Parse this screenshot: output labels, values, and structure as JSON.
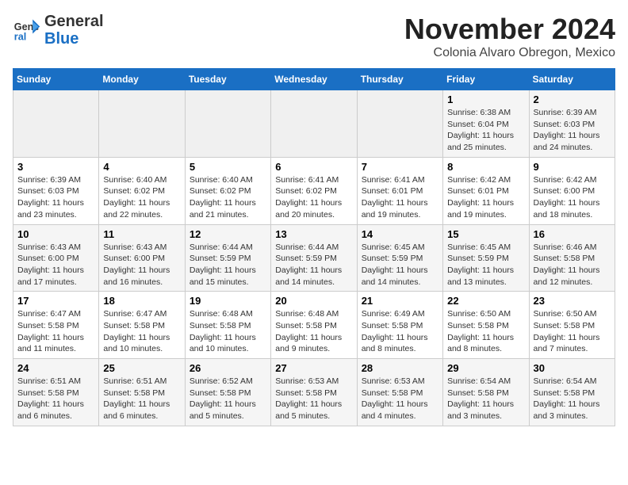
{
  "logo": {
    "general": "General",
    "blue": "Blue"
  },
  "header": {
    "month": "November 2024",
    "location": "Colonia Alvaro Obregon, Mexico"
  },
  "weekdays": [
    "Sunday",
    "Monday",
    "Tuesday",
    "Wednesday",
    "Thursday",
    "Friday",
    "Saturday"
  ],
  "weeks": [
    [
      {
        "day": "",
        "info": ""
      },
      {
        "day": "",
        "info": ""
      },
      {
        "day": "",
        "info": ""
      },
      {
        "day": "",
        "info": ""
      },
      {
        "day": "",
        "info": ""
      },
      {
        "day": "1",
        "info": "Sunrise: 6:38 AM\nSunset: 6:04 PM\nDaylight: 11 hours and 25 minutes."
      },
      {
        "day": "2",
        "info": "Sunrise: 6:39 AM\nSunset: 6:03 PM\nDaylight: 11 hours and 24 minutes."
      }
    ],
    [
      {
        "day": "3",
        "info": "Sunrise: 6:39 AM\nSunset: 6:03 PM\nDaylight: 11 hours and 23 minutes."
      },
      {
        "day": "4",
        "info": "Sunrise: 6:40 AM\nSunset: 6:02 PM\nDaylight: 11 hours and 22 minutes."
      },
      {
        "day": "5",
        "info": "Sunrise: 6:40 AM\nSunset: 6:02 PM\nDaylight: 11 hours and 21 minutes."
      },
      {
        "day": "6",
        "info": "Sunrise: 6:41 AM\nSunset: 6:02 PM\nDaylight: 11 hours and 20 minutes."
      },
      {
        "day": "7",
        "info": "Sunrise: 6:41 AM\nSunset: 6:01 PM\nDaylight: 11 hours and 19 minutes."
      },
      {
        "day": "8",
        "info": "Sunrise: 6:42 AM\nSunset: 6:01 PM\nDaylight: 11 hours and 19 minutes."
      },
      {
        "day": "9",
        "info": "Sunrise: 6:42 AM\nSunset: 6:00 PM\nDaylight: 11 hours and 18 minutes."
      }
    ],
    [
      {
        "day": "10",
        "info": "Sunrise: 6:43 AM\nSunset: 6:00 PM\nDaylight: 11 hours and 17 minutes."
      },
      {
        "day": "11",
        "info": "Sunrise: 6:43 AM\nSunset: 6:00 PM\nDaylight: 11 hours and 16 minutes."
      },
      {
        "day": "12",
        "info": "Sunrise: 6:44 AM\nSunset: 5:59 PM\nDaylight: 11 hours and 15 minutes."
      },
      {
        "day": "13",
        "info": "Sunrise: 6:44 AM\nSunset: 5:59 PM\nDaylight: 11 hours and 14 minutes."
      },
      {
        "day": "14",
        "info": "Sunrise: 6:45 AM\nSunset: 5:59 PM\nDaylight: 11 hours and 14 minutes."
      },
      {
        "day": "15",
        "info": "Sunrise: 6:45 AM\nSunset: 5:59 PM\nDaylight: 11 hours and 13 minutes."
      },
      {
        "day": "16",
        "info": "Sunrise: 6:46 AM\nSunset: 5:58 PM\nDaylight: 11 hours and 12 minutes."
      }
    ],
    [
      {
        "day": "17",
        "info": "Sunrise: 6:47 AM\nSunset: 5:58 PM\nDaylight: 11 hours and 11 minutes."
      },
      {
        "day": "18",
        "info": "Sunrise: 6:47 AM\nSunset: 5:58 PM\nDaylight: 11 hours and 10 minutes."
      },
      {
        "day": "19",
        "info": "Sunrise: 6:48 AM\nSunset: 5:58 PM\nDaylight: 11 hours and 10 minutes."
      },
      {
        "day": "20",
        "info": "Sunrise: 6:48 AM\nSunset: 5:58 PM\nDaylight: 11 hours and 9 minutes."
      },
      {
        "day": "21",
        "info": "Sunrise: 6:49 AM\nSunset: 5:58 PM\nDaylight: 11 hours and 8 minutes."
      },
      {
        "day": "22",
        "info": "Sunrise: 6:50 AM\nSunset: 5:58 PM\nDaylight: 11 hours and 8 minutes."
      },
      {
        "day": "23",
        "info": "Sunrise: 6:50 AM\nSunset: 5:58 PM\nDaylight: 11 hours and 7 minutes."
      }
    ],
    [
      {
        "day": "24",
        "info": "Sunrise: 6:51 AM\nSunset: 5:58 PM\nDaylight: 11 hours and 6 minutes."
      },
      {
        "day": "25",
        "info": "Sunrise: 6:51 AM\nSunset: 5:58 PM\nDaylight: 11 hours and 6 minutes."
      },
      {
        "day": "26",
        "info": "Sunrise: 6:52 AM\nSunset: 5:58 PM\nDaylight: 11 hours and 5 minutes."
      },
      {
        "day": "27",
        "info": "Sunrise: 6:53 AM\nSunset: 5:58 PM\nDaylight: 11 hours and 5 minutes."
      },
      {
        "day": "28",
        "info": "Sunrise: 6:53 AM\nSunset: 5:58 PM\nDaylight: 11 hours and 4 minutes."
      },
      {
        "day": "29",
        "info": "Sunrise: 6:54 AM\nSunset: 5:58 PM\nDaylight: 11 hours and 3 minutes."
      },
      {
        "day": "30",
        "info": "Sunrise: 6:54 AM\nSunset: 5:58 PM\nDaylight: 11 hours and 3 minutes."
      }
    ]
  ]
}
